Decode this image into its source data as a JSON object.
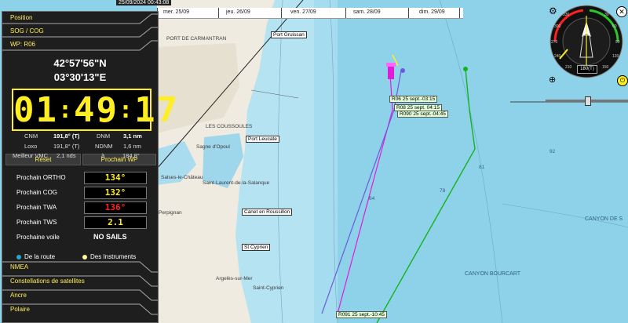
{
  "timebar": {
    "clock": "25/09/2024 00:43:08",
    "days": [
      "mer. 25/09",
      "jeu. 26/09",
      "ven. 27/09",
      "sam. 28/09",
      "dim. 29/09"
    ]
  },
  "panel": {
    "sections_top": [
      "Position",
      "SOG / COG",
      "WP: R06"
    ],
    "latitude": "42°57'56\"N",
    "longitude": "03°30'13\"E",
    "timer": [
      "01",
      "49",
      "17"
    ],
    "nav": {
      "cnm_label": "CNM",
      "cnm_value": "191,8° (T)",
      "dnm_label": "DNM",
      "dnm_value": "3,1 nm",
      "loxo_label": "Loxo",
      "loxo_value": "191,8° (T)",
      "ndnm_label": "NDNM",
      "ndnm_value": "1,6 nm",
      "vmc_label": "Meilleur VMC",
      "vmc_value": "2,1 nds",
      "vmc_at": "à",
      "vmc_angle": "184,8°"
    },
    "reset_label": "Reset",
    "next_wp_label": "Prochain WP",
    "fields": [
      {
        "label": "Prochain ORTHO",
        "value": "134°",
        "color": "#ffee22"
      },
      {
        "label": "Prochain COG",
        "value": "132°",
        "color": "#ffee22"
      },
      {
        "label": "Prochain TWA",
        "value": "136°",
        "color": "#ff2222"
      },
      {
        "label": "Prochain TWS",
        "value": "2.1",
        "color": "#ffee22"
      }
    ],
    "sail_label": "Prochaine voile",
    "sail_value": "NO SAILS",
    "legend_route": "De la route",
    "legend_instruments": "Des Instruments",
    "sections_bottom": [
      "NMEA",
      "Constellations de satellites",
      "Ancre",
      "Polaire"
    ]
  },
  "map": {
    "ports": [
      "Port Gruissan",
      "Port Leucate",
      "Canet en Roussillon",
      "St Cyprien"
    ],
    "towns": [
      "PORT DE CARMANTRAN",
      "LES COUSSOULES",
      "Sagne d'Opoul",
      "Salses-le-Château",
      "Saint-Laurent-de-la-Salanque",
      "Perpignan",
      "Argelès-sur-Mer",
      "Saint-Cyprien"
    ],
    "seafloor": [
      "CANYON DE S",
      "CANYON BOURCART"
    ],
    "waypoints": [
      "R06 25 sept.-03:15",
      "R08 25 sept. 04:15",
      "R090 25 sept.-04:45",
      "R091 25 sept.-10:45"
    ]
  },
  "compass": {
    "speed": "180(T)",
    "ticks": [
      "330",
      "300",
      "270",
      "240",
      "210",
      "30",
      "60",
      "90",
      "120",
      "150"
    ]
  }
}
